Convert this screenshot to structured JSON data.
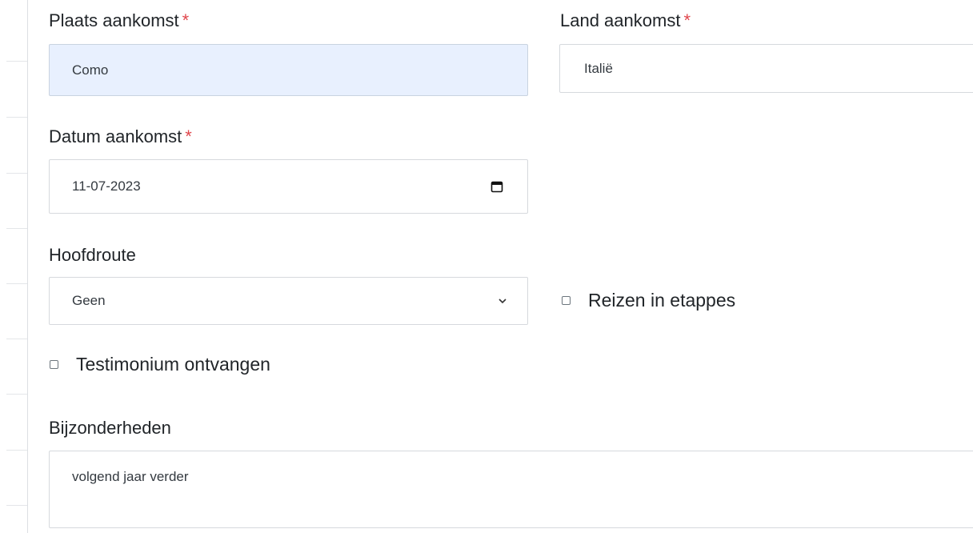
{
  "fields": {
    "arrival_place": {
      "label": "Plaats aankomst",
      "required_mark": "*",
      "value": "Como"
    },
    "arrival_country": {
      "label": "Land aankomst",
      "required_mark": "*",
      "value": "Italië"
    },
    "arrival_date": {
      "label": "Datum aankomst",
      "required_mark": "*",
      "value": "11-07-2023",
      "icon": "calendar-icon"
    },
    "main_route": {
      "label": "Hoofdroute",
      "selected": "Geen",
      "icon": "chevron-down-icon"
    },
    "stages_checkbox": {
      "label": "Reizen in etappes",
      "checked": false
    },
    "testimonial_checkbox": {
      "label": "Testimonium ontvangen",
      "checked": false
    },
    "details": {
      "label": "Bijzonderheden",
      "value": "volgend jaar verder"
    }
  },
  "colors": {
    "required": "#e0464c",
    "autofill_bg": "#e8f0fe",
    "border": "#d6d9dd"
  }
}
